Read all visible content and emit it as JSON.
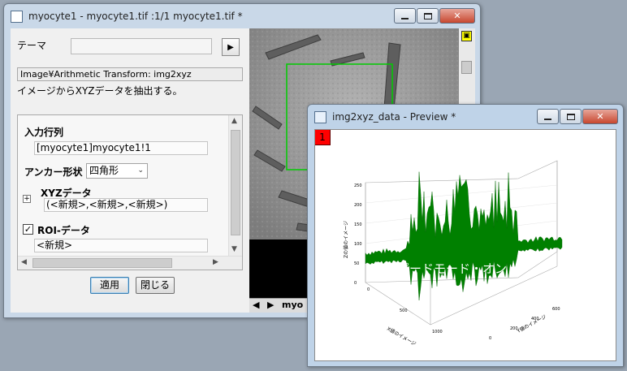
{
  "main_window": {
    "title": "myocyte1 - myocyte1.tif :1/1 myocyte1.tif *",
    "theme_label": "テーマ",
    "theme_value": "",
    "path": "Image¥Arithmetic Transform: img2xyz",
    "description": "イメージからXYZデータを抽出する。",
    "settings": {
      "input_matrix_label": "入力行列",
      "input_matrix_value": "[myocyte1]myocyte1!1",
      "anchor_label": "アンカー形状",
      "anchor_value": "四角形",
      "xyz_label": "XYZデータ",
      "xyz_value": "(<新規>,<新規>,<新規>)",
      "roi_label": "ROI-データ",
      "roi_checked": true,
      "roi_value": "<新規>"
    },
    "apply_button": "適用",
    "close_button": "閉じる",
    "sheet_tab": "myo"
  },
  "preview_window": {
    "title": "img2xyz_data - Preview *",
    "layer_number": "1",
    "overlay_text": "スピードモード・オン",
    "z_axis_label": "Zの値のイメージ",
    "x_axis_label": "X値のイメージ",
    "y_axis_label": "Y値のイメージ",
    "z_ticks": [
      "250",
      "200",
      "150",
      "100",
      "50",
      "0"
    ],
    "x_ticks": [
      "0",
      "500",
      "1000"
    ],
    "y_ticks": [
      "0",
      "200",
      "400",
      "600"
    ]
  },
  "colors": {
    "surface": "#008000",
    "roi_box": "#00cc00",
    "layer_badge": "#ff0000"
  }
}
